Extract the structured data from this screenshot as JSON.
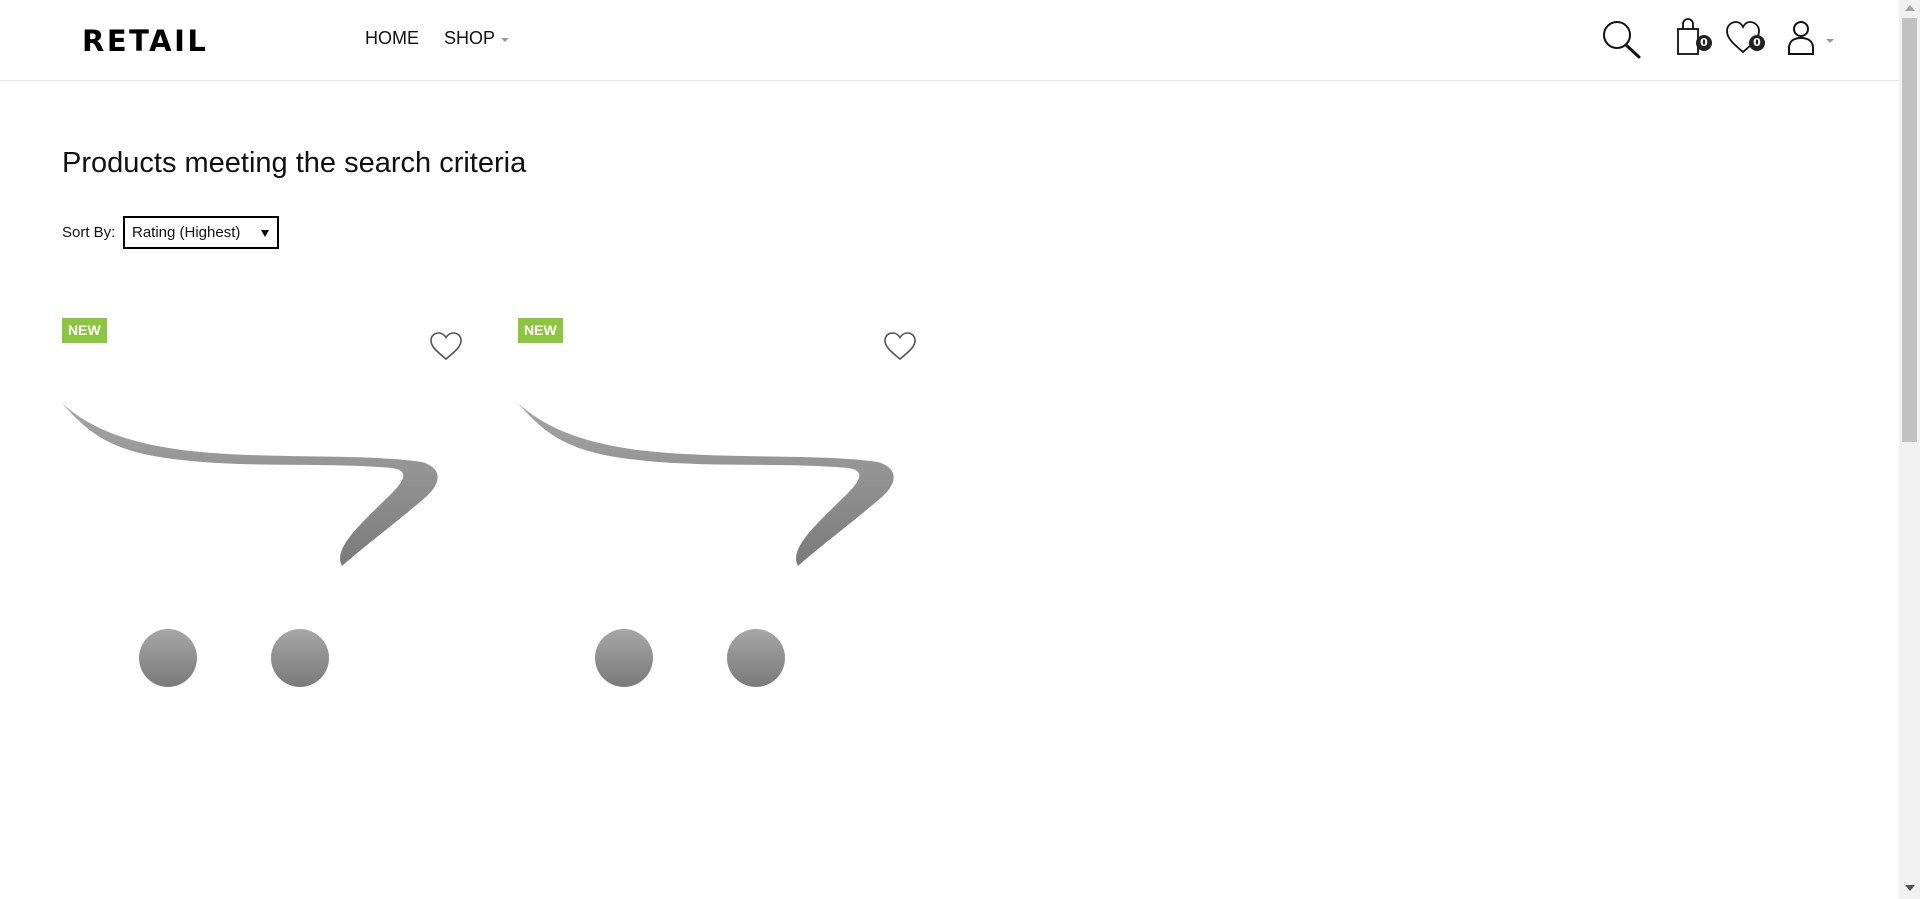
{
  "header": {
    "logo": "RETAIL",
    "nav": [
      {
        "label": "HOME"
      },
      {
        "label": "SHOP"
      }
    ],
    "cart_count": "0",
    "wishlist_count": "0"
  },
  "main": {
    "title": "Products meeting the search criteria",
    "sort_label": "Sort By:",
    "sort_value": "Rating (Highest)",
    "products": [
      {
        "badge": "NEW"
      },
      {
        "badge": "NEW"
      }
    ]
  },
  "colors": {
    "badge_bg": "#8cc63f",
    "placeholder_gray": "#8c8c8c"
  },
  "icons": [
    "search-icon",
    "cart-icon",
    "heart-icon",
    "user-icon",
    "chevron-down-icon",
    "opencart-placeholder-image"
  ]
}
